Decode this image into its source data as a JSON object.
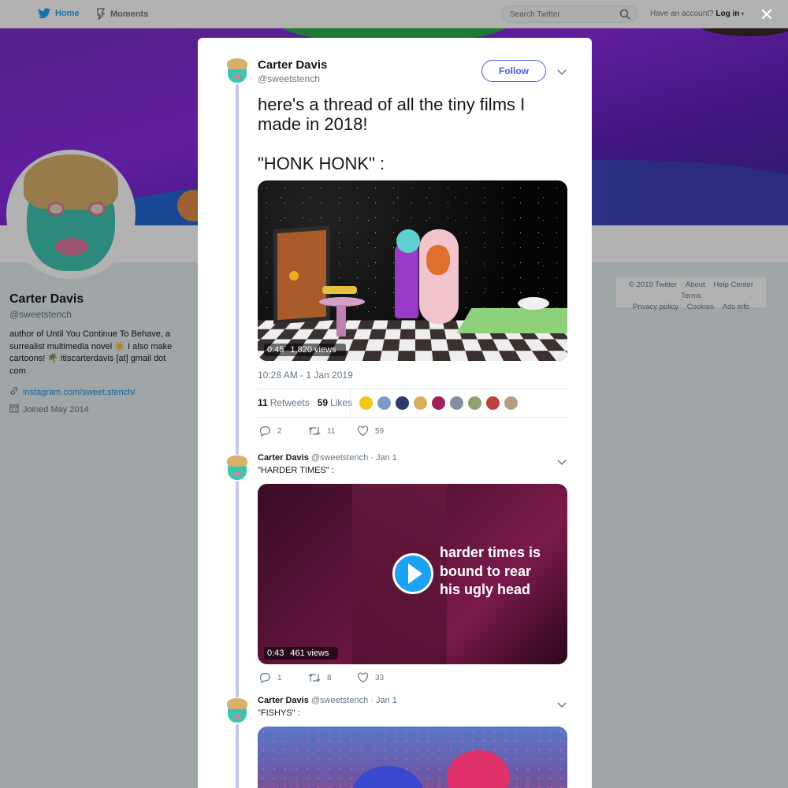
{
  "nav": {
    "home_label": "Home",
    "moments_label": "Moments",
    "search_placeholder": "Search Twitter",
    "account_prompt": "Have an account?",
    "login_label": "Log in"
  },
  "profile": {
    "name": "Carter Davis",
    "handle": "@sweetstench",
    "bio": "author of Until You Continue To Behave, a surrealist multimedia novel ☀️ I also make cartoons! 🌴 itiscarterdavis [at] gmail dot com",
    "link": "instagram.com/sweet.stench/",
    "joined": "Joined May 2014"
  },
  "footer": {
    "copyright": "© 2019 Twitter",
    "about": "About",
    "help": "Help Center",
    "terms": "Terms",
    "privacy": "Privacy policy",
    "cookies": "Cookies",
    "ads": "Ads info"
  },
  "main_tweet": {
    "name": "Carter Davis",
    "handle": "@sweetstench",
    "follow_label": "Follow",
    "text": "here's a thread of all the tiny films I made in 2018!\n\n\"HONK HONK\" :",
    "video_duration": "0:45",
    "video_views": "1,820 views",
    "timestamp": "10:28 AM - 1 Jan 2019",
    "retweets_count": "11",
    "retweets_label": "Retweets",
    "likes_count": "59",
    "likes_label": "Likes",
    "actions": {
      "replies": "2",
      "retweets": "11",
      "likes": "59"
    }
  },
  "replies": [
    {
      "name": "Carter Davis",
      "handle": "@sweetstench",
      "date": "· Jan 1",
      "text": "\"HARDER TIMES\" :",
      "video_overlay_text": "harder times is\nbound to rear\nhis ugly head",
      "video_duration": "0:43",
      "video_views": "461 views",
      "actions": {
        "replies": "1",
        "retweets": "8",
        "likes": "33"
      }
    },
    {
      "name": "Carter Davis",
      "handle": "@sweetstench",
      "date": "· Jan 1",
      "text": "\"FISHYS\" :"
    }
  ],
  "colors": {
    "accent": "#4a5fd6",
    "link": "#1b95e0",
    "thread_line": "#c4c6f4",
    "play_button": "#1da1f2"
  },
  "icons": [
    "twitter-bird-icon",
    "moments-icon",
    "search-icon",
    "close-icon",
    "chevron-down-icon",
    "reply-icon",
    "retweet-icon",
    "like-icon",
    "link-icon",
    "calendar-icon",
    "play-icon"
  ]
}
